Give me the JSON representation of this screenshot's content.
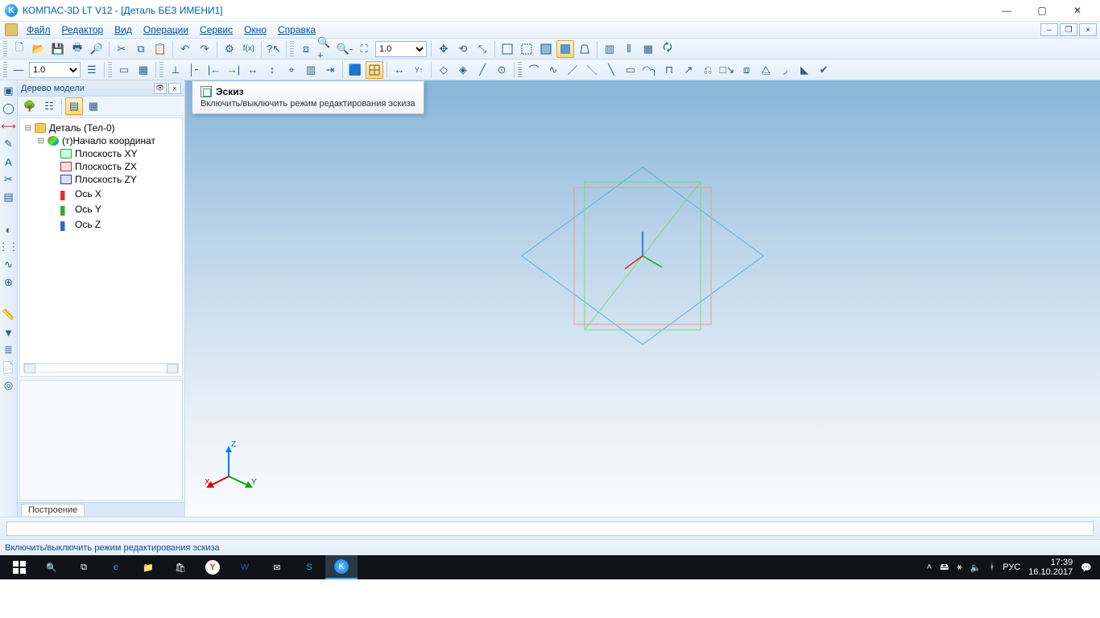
{
  "app": {
    "title": "КОМПАС-3D LT V12 - [Деталь БЕЗ ИМЕНИ1]"
  },
  "menu": {
    "file": "Файл",
    "edit": "Редактор",
    "view": "Вид",
    "ops": "Операции",
    "service": "Сервис",
    "window": "Окно",
    "help": "Справка"
  },
  "toolbar": {
    "stroke_combo": "1.0",
    "scale_combo": "1.0"
  },
  "tree": {
    "title": "Дерево модели",
    "root": "Деталь (Тел-0)",
    "origin": "(т)Начало координат",
    "items": [
      "Плоскость XY",
      "Плоскость ZX",
      "Плоскость ZY",
      "Ось X",
      "Ось Y",
      "Ось Z"
    ],
    "tab": "Построение"
  },
  "tooltip": {
    "title": "Эскиз",
    "body": "Включить/выключить режим редактирования эскиза"
  },
  "triad": {
    "x": "X",
    "y": "Y",
    "z": "Z"
  },
  "status": {
    "hint": "Включить/выключить режим редактирования эскиза"
  },
  "taskbar": {
    "lang": "РУС",
    "time": "17:39",
    "date": "16.10.2017"
  }
}
